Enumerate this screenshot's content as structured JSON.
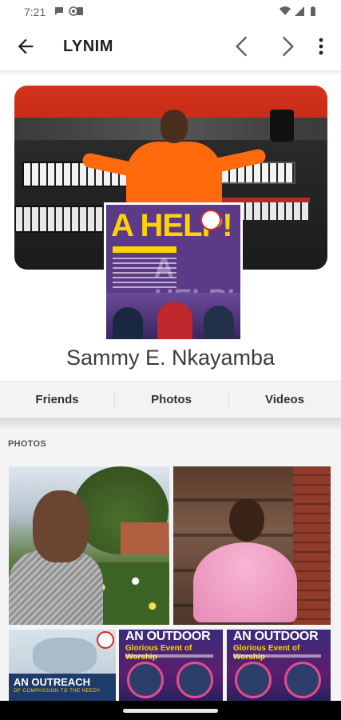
{
  "status_bar": {
    "time": "7:21",
    "left_icons": [
      "chat-bubble-icon",
      "at-sign-icon",
      "sd-card-icon"
    ],
    "right_icons": [
      "wifi-icon",
      "signal-icon",
      "battery-icon"
    ]
  },
  "app_bar": {
    "title": "LYNIM",
    "icons": [
      "back-arrow-icon",
      "chevron-left-icon",
      "chevron-right-icon",
      "more-vert-icon"
    ]
  },
  "profile": {
    "name": "Sammy E. Nkayamba",
    "profile_picture_text": "A HELP!",
    "profile_picture_subtitle": "for Spiritual & Mental Health"
  },
  "tabs": [
    {
      "label": "Friends"
    },
    {
      "label": "Photos"
    },
    {
      "label": "Videos"
    }
  ],
  "photos_section": {
    "label": "PHOTOS",
    "thumbnails": [
      {
        "headline": "AN OUTREACH",
        "subline": "OF COMPASSION TO THE NEEDY"
      },
      {
        "headline": "AN OUTDOOR",
        "subline": "Glorious Event of Worship"
      },
      {
        "headline": "AN OUTDOOR",
        "subline": "Glorious Event of Worship"
      }
    ]
  },
  "colors": {
    "accent_orange": "#ff6a0d",
    "poster_purple": "#5c3a87",
    "poster_yellow": "#ffd200"
  }
}
